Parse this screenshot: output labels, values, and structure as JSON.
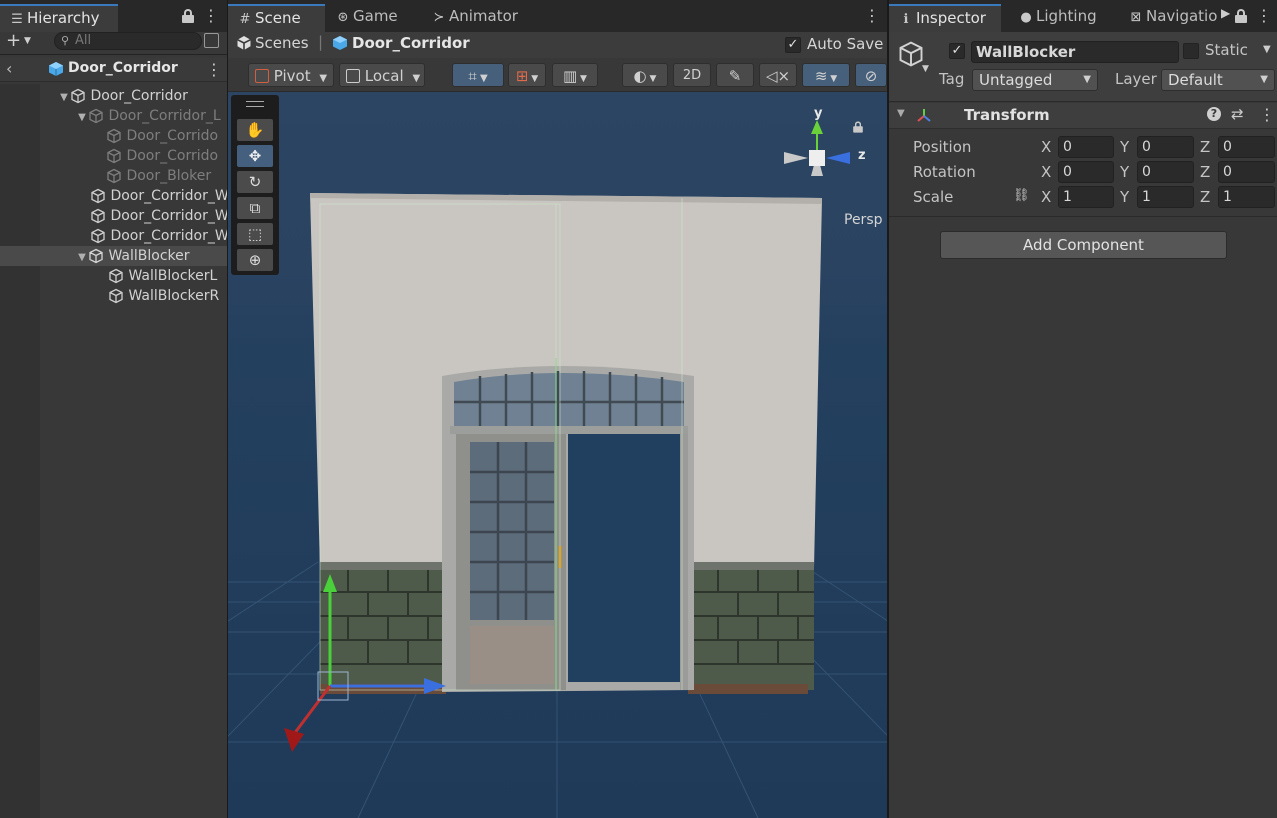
{
  "hierarchy": {
    "tab_label": "Hierarchy",
    "search_placeholder": "All",
    "root_scene": "Door_Corridor",
    "items": [
      {
        "label": "Door_Corridor"
      },
      {
        "label": "Door_Corridor_L"
      },
      {
        "label": "Door_Corrido"
      },
      {
        "label": "Door_Corrido"
      },
      {
        "label": "Door_Bloker"
      },
      {
        "label": "Door_Corridor_W"
      },
      {
        "label": "Door_Corridor_W"
      },
      {
        "label": "Door_Corridor_W"
      },
      {
        "label": "WallBlocker"
      },
      {
        "label": "WallBlockerL"
      },
      {
        "label": "WallBlockerR"
      }
    ]
  },
  "scene": {
    "tabs": [
      {
        "label": "Scene",
        "icon": "grid-icon"
      },
      {
        "label": "Game",
        "icon": "gamepad-icon"
      },
      {
        "label": "Animator",
        "icon": "animator-icon"
      }
    ],
    "breadcrumb": {
      "root": "Scenes",
      "current": "Door_Corridor"
    },
    "auto_save_label": "Auto Save",
    "auto_save_checked": true,
    "toolbar": {
      "pivot": "Pivot",
      "space": "Local",
      "mode_2d": "2D"
    },
    "persp_label": "Persp",
    "gizmo": {
      "y": "y",
      "z": "z"
    }
  },
  "inspector": {
    "tabs": [
      {
        "label": "Inspector",
        "icon": "info-icon"
      },
      {
        "label": "Lighting",
        "icon": "bulb-icon"
      },
      {
        "label": "Navigatio",
        "icon": "navigation-icon"
      }
    ],
    "object_name": "WallBlocker",
    "active_checked": true,
    "static_label": "Static",
    "tag_label": "Tag",
    "tag_value": "Untagged",
    "layer_label": "Layer",
    "layer_value": "Default",
    "component_title": "Transform",
    "position": {
      "label": "Position",
      "x": "0",
      "y": "0",
      "z": "0"
    },
    "rotation": {
      "label": "Rotation",
      "x": "0",
      "y": "0",
      "z": "0"
    },
    "scale": {
      "label": "Scale",
      "x": "1",
      "y": "1",
      "z": "1"
    },
    "axis_labels": {
      "x": "X",
      "y": "Y",
      "z": "Z"
    },
    "add_component_label": "Add Component"
  },
  "colors": {
    "accent": "#3a79bb",
    "scene_sky": "#2a4566",
    "panel": "#383838"
  }
}
